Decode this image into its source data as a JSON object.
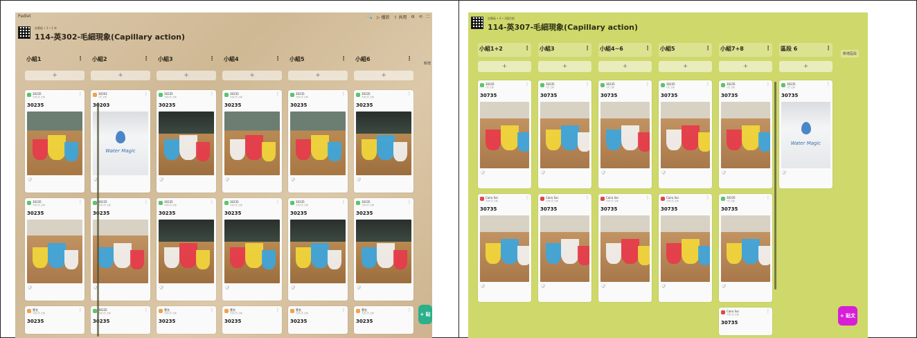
{
  "left": {
    "app_name": "Padlet",
    "toolbar": [
      "🔍",
      "▷ 播放",
      "⇪ 共用",
      "⚙",
      "⟲",
      "⛶"
    ],
    "breadcrumb": "訪客板 • 3 • 1 年",
    "title": "114-英302-毛細現象(Capillary action)",
    "side_label": "新增",
    "post_button": "+ 貼",
    "columns": [
      {
        "name": "小組1",
        "cards": [
          {
            "author": "30235",
            "meta": "大約1天 之前",
            "title": "30235",
            "color": "#5cc46a",
            "photo": "wood"
          },
          {
            "author": "30235",
            "meta": "大約1天 之前",
            "title": "30235",
            "color": "#5cc46a",
            "photo": "table"
          },
          {
            "author": "菅名",
            "meta": "大約1天 之前",
            "title": "30235",
            "color": "#f0a24a"
          }
        ]
      },
      {
        "name": "小組2",
        "cards": [
          {
            "author": "30203",
            "meta": "1天 之前",
            "title": "30203",
            "color": "#f0a24a",
            "photo": "monitor"
          },
          {
            "author": "30235",
            "meta": "大約1天 之前",
            "title": "30235",
            "color": "#5cc46a",
            "photo": "table"
          },
          {
            "author": "30235",
            "meta": "大約1天 之前",
            "title": "30235",
            "color": "#5cc46a"
          }
        ]
      },
      {
        "name": "小組3",
        "cards": [
          {
            "author": "30235",
            "meta": "大約1天 之前",
            "title": "30235",
            "color": "#5cc46a",
            "photo": "dark"
          },
          {
            "author": "30235",
            "meta": "大約1天 之前",
            "title": "30235",
            "color": "#5cc46a",
            "photo": "dark"
          },
          {
            "author": "菅名",
            "meta": "大約1天 之前",
            "title": "30235",
            "color": "#f0a24a"
          }
        ]
      },
      {
        "name": "小組4",
        "cards": [
          {
            "author": "30235",
            "meta": "大約1天 之前",
            "title": "30235",
            "color": "#5cc46a",
            "photo": "wood"
          },
          {
            "author": "30235",
            "meta": "大約1天 之前",
            "title": "30235",
            "color": "#5cc46a",
            "photo": "dark"
          },
          {
            "author": "菅名",
            "meta": "大約1天 之前",
            "title": "30235",
            "color": "#f0a24a"
          }
        ]
      },
      {
        "name": "小組5",
        "cards": [
          {
            "author": "30235",
            "meta": "大約1天 之前",
            "title": "30235",
            "color": "#5cc46a",
            "photo": "wood"
          },
          {
            "author": "30235",
            "meta": "大約1天 之前",
            "title": "30235",
            "color": "#5cc46a",
            "photo": "dark"
          },
          {
            "author": "菅名",
            "meta": "大約1天 之前",
            "title": "30235",
            "color": "#f0a24a"
          }
        ]
      },
      {
        "name": "小組6",
        "cards": [
          {
            "author": "30235",
            "meta": "大約1天 之前",
            "title": "30235",
            "color": "#5cc46a",
            "photo": "dark"
          },
          {
            "author": "30235",
            "meta": "大約1天 之前",
            "title": "30235",
            "color": "#5cc46a",
            "photo": "dark"
          },
          {
            "author": "菅名",
            "meta": "大約1天 之前",
            "title": "30235",
            "color": "#f0a24a"
          }
        ]
      }
    ]
  },
  "right": {
    "breadcrumb": "訪客板 • 3 • 2個月前",
    "title": "114-英307-毛細現象(Capillary action)",
    "side_label": "新增區段",
    "post_button": "+ 貼文",
    "columns": [
      {
        "name": "小組1+2",
        "cards": [
          {
            "author": "30235",
            "meta": "1天 之前",
            "title": "30735",
            "color": "#5cc46a",
            "photo": "table"
          },
          {
            "author": "Cairo Sai",
            "meta": "大約1天 之前",
            "title": "30735",
            "color": "#e04848",
            "photo": "table"
          }
        ]
      },
      {
        "name": "小組3",
        "cards": [
          {
            "author": "30235",
            "meta": "1天 之前",
            "title": "30735",
            "color": "#5cc46a",
            "photo": "table"
          },
          {
            "author": "Cairo Sai",
            "meta": "大約1天 之前",
            "title": "30735",
            "color": "#e04848",
            "photo": "table"
          }
        ]
      },
      {
        "name": "小組4~6",
        "cards": [
          {
            "author": "30235",
            "meta": "1天 之前",
            "title": "30735",
            "color": "#5cc46a",
            "photo": "table"
          },
          {
            "author": "Cairo Sai",
            "meta": "大約1天 之前",
            "title": "30735",
            "color": "#e04848",
            "photo": "table"
          }
        ]
      },
      {
        "name": "小組5",
        "cards": [
          {
            "author": "30235",
            "meta": "1天 之前",
            "title": "30735",
            "color": "#5cc46a",
            "photo": "table"
          },
          {
            "author": "Cairo Sai",
            "meta": "大約1天 之前",
            "title": "30735",
            "color": "#e04848",
            "photo": "table"
          }
        ]
      },
      {
        "name": "小組7+8",
        "cards": [
          {
            "author": "30235",
            "meta": "1天 之前",
            "title": "30735",
            "color": "#5cc46a",
            "photo": "table"
          },
          {
            "author": "30235",
            "meta": "1天 之前",
            "title": "30735",
            "color": "#5cc46a",
            "photo": "table"
          },
          {
            "author": "Cairo Sai",
            "meta": "大約1天 之前",
            "title": "30735",
            "color": "#e04848"
          }
        ]
      },
      {
        "name": "區段 6",
        "cards": [
          {
            "author": "30235",
            "meta": "1天 之前",
            "title": "30735",
            "color": "#5cc46a",
            "photo": "monitor"
          }
        ]
      }
    ]
  },
  "watermark_text": "Water Magic",
  "comment_icon": "◌̷"
}
